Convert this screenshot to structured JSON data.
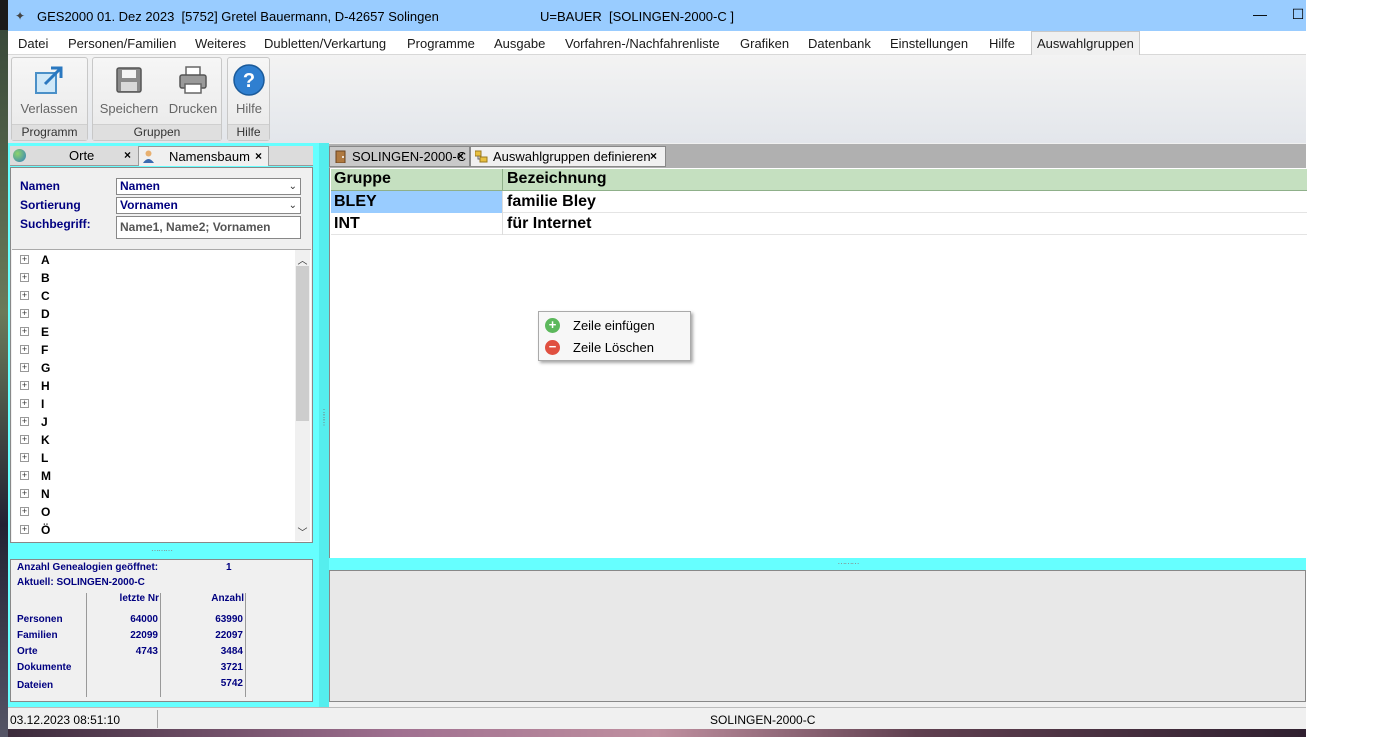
{
  "window": {
    "title": "GES2000 01. Dez 2023  [5752] Gretel Bauermann, D-42657 Solingen",
    "title_user": "U=BAUER  [SOLINGEN-2000-C ]",
    "minimize_glyph": "—",
    "maximize_glyph": "☐"
  },
  "menu": {
    "items": [
      "Datei",
      "Personen/Familien",
      "Weiteres",
      "Dubletten/Verkartung",
      "Programme",
      "Ausgabe",
      "Vorfahren-/Nachfahrenliste",
      "Grafiken",
      "Datenbank",
      "Einstellungen",
      "Hilfe",
      "Auswahlgruppen"
    ],
    "active": "Auswahlgruppen"
  },
  "ribbon": {
    "groups": [
      {
        "label": "Programm",
        "buttons": [
          {
            "label": "Verlassen",
            "icon": "exit-icon"
          }
        ]
      },
      {
        "label": "Gruppen",
        "buttons": [
          {
            "label": "Speichern",
            "icon": "save-icon"
          },
          {
            "label": "Drucken",
            "icon": "print-icon"
          }
        ]
      },
      {
        "label": "Hilfe",
        "buttons": [
          {
            "label": "Hilfe",
            "icon": "help-icon"
          }
        ]
      }
    ]
  },
  "left_tabs": [
    {
      "label": "Orte",
      "icon": "globe-icon",
      "close": "×"
    },
    {
      "label": "Namensbaum",
      "icon": "person-icon",
      "close": "×"
    }
  ],
  "search": {
    "namen_label": "Namen",
    "namen_value": "Namen",
    "sortierung_label": "Sortierung",
    "sortierung_value": "Vornamen",
    "suchbegriff_label": "Suchbegriff:",
    "suchbegriff_value": "Name1, Name2; Vornamen"
  },
  "tree": {
    "items": [
      "A",
      "B",
      "C",
      "D",
      "E",
      "F",
      "G",
      "H",
      "I",
      "J",
      "K",
      "L",
      "M",
      "N",
      "O",
      "Ö"
    ],
    "expander": "+"
  },
  "stats": {
    "opened_label": "Anzahl Genealogien geöffnet:",
    "opened_value": "1",
    "current_label": "Aktuell: SOLINGEN-2000-C",
    "col_last": "letzte Nr",
    "col_count": "Anzahl",
    "rows": [
      {
        "label": "Personen",
        "last": "64000",
        "count": "63990"
      },
      {
        "label": "Familien",
        "last": "22099",
        "count": "22097"
      },
      {
        "label": "Orte",
        "last": "4743",
        "count": "3484"
      },
      {
        "label": "Dokumente",
        "last": "",
        "count": "3721"
      },
      {
        "label": "Dateien",
        "last": "",
        "count": "5742"
      }
    ]
  },
  "right_tabs": [
    {
      "label": "SOLINGEN-2000-C",
      "icon": "door-icon",
      "close": "×"
    },
    {
      "label": "Auswahlgruppen definieren",
      "icon": "groups-icon",
      "close": "×"
    }
  ],
  "grid": {
    "columns": [
      "Gruppe",
      "Bezeichnung"
    ],
    "rows": [
      {
        "gruppe": "BLEY",
        "bezeichnung": "familie Bley",
        "selected": true
      },
      {
        "gruppe": "INT",
        "bezeichnung": "für Internet",
        "selected": false
      }
    ]
  },
  "context_menu": {
    "items": [
      {
        "label": "Zeile einfügen",
        "icon": "add-icon",
        "glyph": "+",
        "color": "#5cb85c"
      },
      {
        "label": "Zeile Löschen",
        "icon": "remove-icon",
        "glyph": "−",
        "color": "#e05040"
      }
    ]
  },
  "statusbar": {
    "datetime": "03.12.2023 08:51:10",
    "database": "SOLINGEN-2000-C"
  },
  "colors": {
    "titlebar": "#99ccff",
    "accent_cyan": "#66ffff",
    "label_navy": "#000080",
    "selected_cell": "#99ccff",
    "grid_header": "#c5e0c0"
  }
}
